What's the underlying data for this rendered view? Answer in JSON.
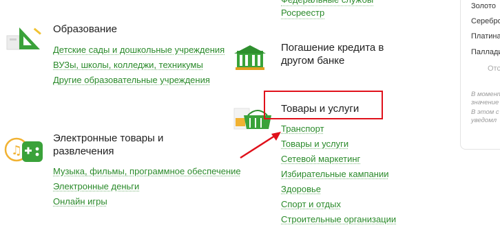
{
  "top_links": [
    "Федеральные службы",
    "Росреестр"
  ],
  "categories": {
    "education": {
      "title": "Образование",
      "links": [
        "Детские сады и дошкольные учреждения",
        "ВУЗы, школы, колледжи, техникумы",
        "Другие образовательные учреждения"
      ]
    },
    "digital": {
      "title": "Электронные товары и развлечения",
      "links": [
        "Музыка, фильмы, программное обеспечение",
        "Электронные деньги",
        "Онлайн игры"
      ]
    },
    "loan": {
      "title": "Погашение кредита в другом банке"
    },
    "goods": {
      "title": "Товары и услуги",
      "links": [
        "Транспорт",
        "Товары и услуги",
        "Сетевой маркетинг",
        "Избирательные кампании",
        "Здоровье",
        "Спорт и отдых",
        "Строительные организации"
      ]
    }
  },
  "right_panel": {
    "metals": [
      "Золото",
      "Серебро",
      "Платина",
      "Палладий"
    ],
    "button_partial": "Отс",
    "note_lines": [
      "В момент",
      "значение",
      "В этом с",
      "уведомл"
    ]
  },
  "colors": {
    "link": "#2a8a2a",
    "highlight": "#e0101a",
    "icon_green": "#3aa23a"
  }
}
